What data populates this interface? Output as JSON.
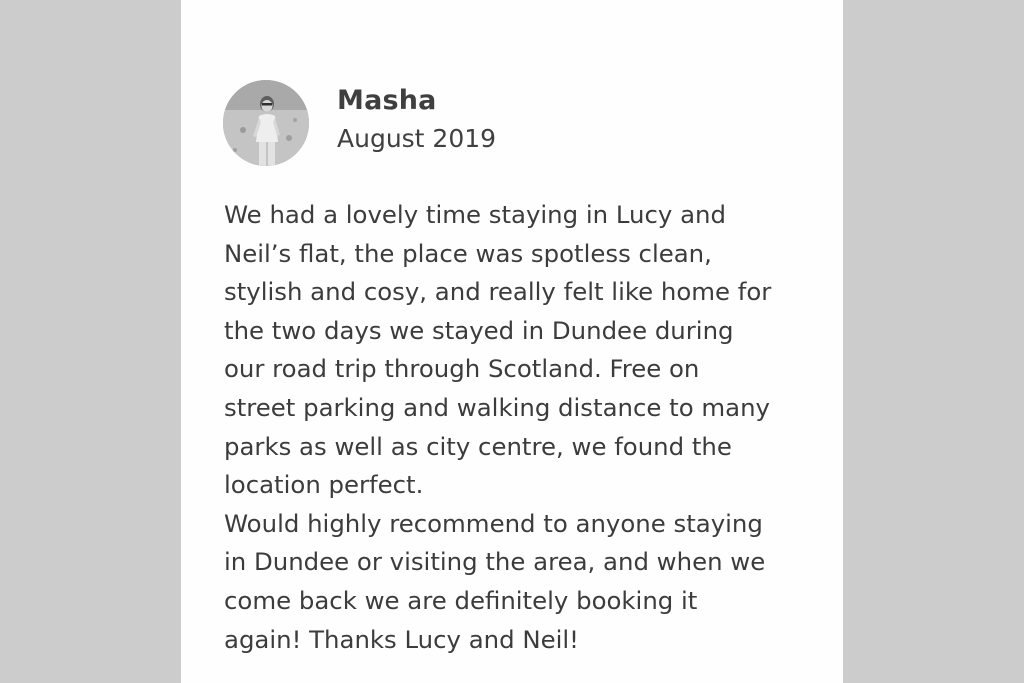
{
  "review": {
    "reviewer_name": "Masha",
    "date": "August 2019",
    "avatar_icon": "reviewer-photo",
    "text": "We had a lovely time staying in Lucy and\nNeil’s flat, the place was spotless clean,\nstylish and cosy, and really felt like home for\nthe two days we stayed in Dundee during\nour road trip through Scotland. Free on\nstreet parking and walking distance to many\nparks as well as city centre, we found the\nlocation perfect.\nWould highly recommend to anyone staying\nin Dundee or visiting the area, and when we\ncome back we are definitely booking it\nagain! Thanks Lucy and Neil!"
  },
  "colors": {
    "background": "#cccccc",
    "card": "#fefefe",
    "text": "#3c3c3c"
  }
}
